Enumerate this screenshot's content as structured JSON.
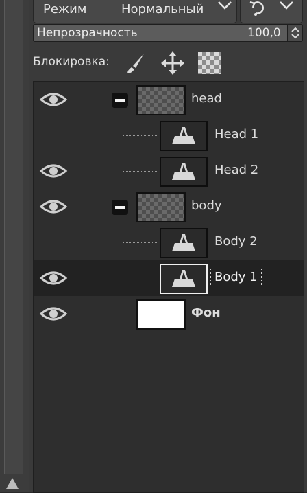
{
  "mode": {
    "label": "Режим",
    "value": "Нормальный"
  },
  "opacity": {
    "label": "Непрозрачность",
    "value": "100,0"
  },
  "lock": {
    "label": "Блокировка:"
  },
  "layers": [
    {
      "name": "head",
      "type": "group",
      "visible": true,
      "expanded": true
    },
    {
      "name": "Head 1",
      "type": "text",
      "visible": false
    },
    {
      "name": "Head 2",
      "type": "text",
      "visible": true
    },
    {
      "name": "body",
      "type": "group",
      "visible": true,
      "expanded": true
    },
    {
      "name": "Body 2",
      "type": "text",
      "visible": false
    },
    {
      "name": "Body 1",
      "type": "text",
      "visible": true,
      "selected": true
    },
    {
      "name": "Фон",
      "type": "image",
      "visible": true
    }
  ],
  "colors": {
    "panel_bg": "#3a3a3a",
    "list_bg": "#2e2e2e",
    "selected_row": "#222222",
    "text": "#dcdcdc"
  },
  "icons": [
    "chevron-down-icon",
    "reset-mode-icon",
    "paintbrush-icon",
    "move-icon",
    "checkerboard-icon",
    "eye-icon",
    "collapse-icon",
    "text-layer-icon"
  ]
}
